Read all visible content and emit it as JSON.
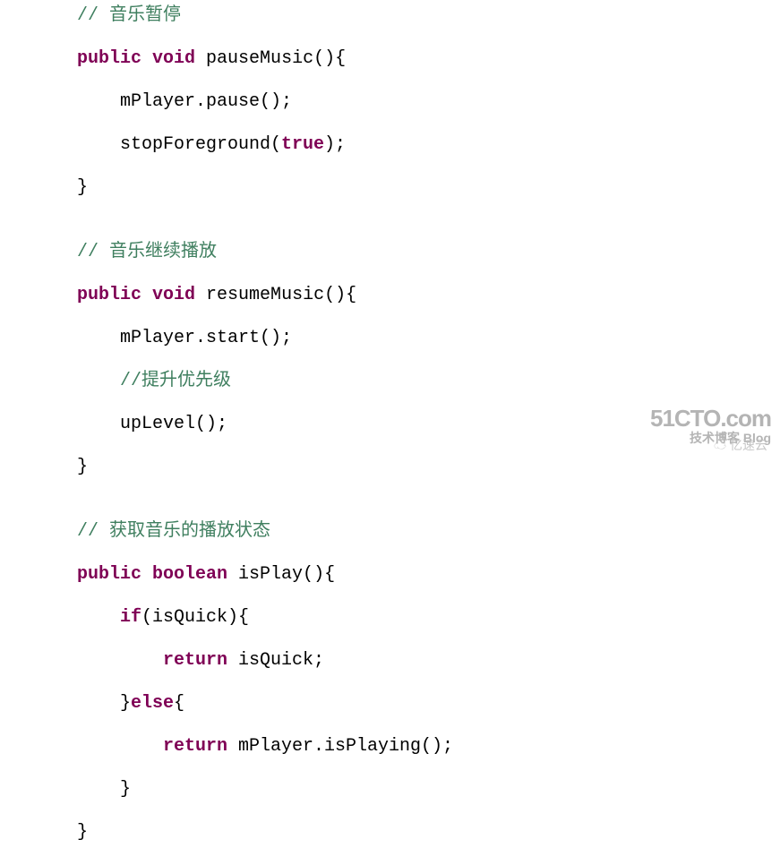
{
  "code": {
    "block1": {
      "comment": "// 音乐暂停",
      "sig_kw1": "public",
      "sig_kw2": "void",
      "sig_rest": " pauseMusic(){",
      "line1a": "mPlayer.pause();",
      "line2a": "stopForeground(",
      "line2a_kw": "true",
      "line2a_end": ");",
      "close": "}"
    },
    "block2": {
      "comment": "// 音乐继续播放",
      "sig_kw1": "public",
      "sig_kw2": "void",
      "sig_rest": " resumeMusic(){",
      "line1a": "mPlayer.start();",
      "line_comment": "//提升优先级",
      "line2a": "upLevel();",
      "close": "}"
    },
    "block3": {
      "comment": "// 获取音乐的播放状态",
      "sig_kw1": "public",
      "sig_kw2": "boolean",
      "sig_rest": " isPlay(){",
      "if_kw": "if",
      "if_rest": "(isQuick){",
      "ret_kw": "return",
      "ret1_rest": " isQuick;",
      "else_pre": "}",
      "else_kw": "else",
      "else_post": "{",
      "ret2_rest": " mPlayer.isPlaying();",
      "close_inner": "}",
      "close_outer": "}"
    }
  },
  "watermark": {
    "main": "51CTO.com",
    "sub": "技术博客  Blog",
    "extra": "亿速云"
  }
}
